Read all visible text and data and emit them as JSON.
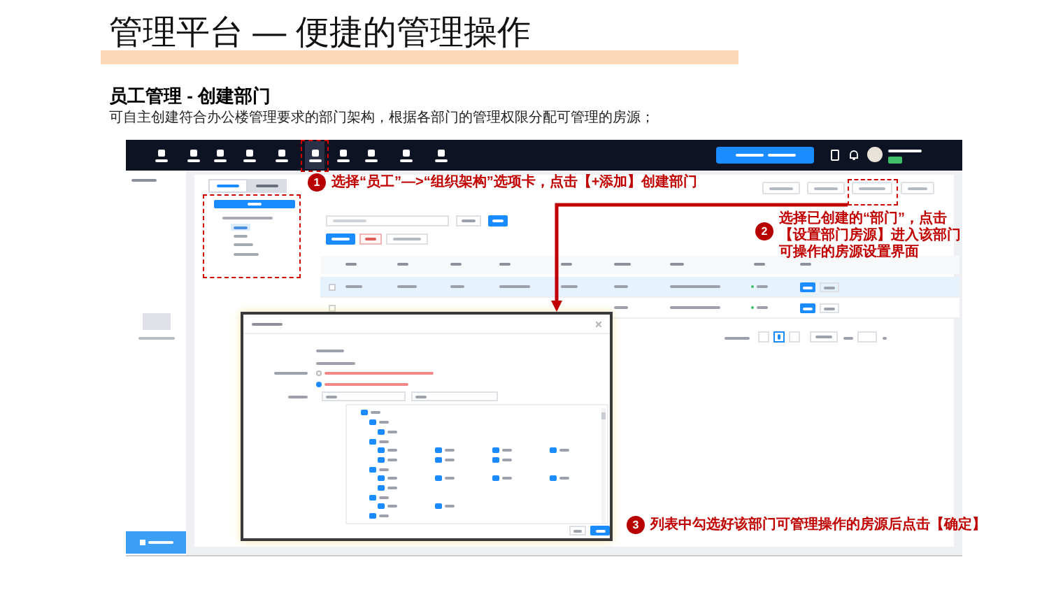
{
  "slide": {
    "title": "管理平台 — 便捷的管理操作",
    "heading": "员工管理 - 创建部门",
    "description": "可自主创建符合办公楼管理要求的部门架构，根据各部门的管理权限分配可管理的房源；"
  },
  "callouts": [
    {
      "number": "1",
      "text": "选择“员工”—>“组织架构”选项卡，点击【+添加】创建部门"
    },
    {
      "number": "2",
      "text": "选择已创建的“部门”，点击【设置部门房源】进入该部门可操作的房源设置界面"
    },
    {
      "number": "3",
      "text": "列表中勾选好该部门可管理操作的房源后点击【确定】"
    }
  ],
  "app_screenshot": {
    "nav_items": [
      {
        "selected": false
      },
      {
        "selected": false
      },
      {
        "selected": false
      },
      {
        "selected": false
      },
      {
        "selected": false
      },
      {
        "selected": true
      },
      {
        "selected": false
      },
      {
        "selected": false
      },
      {
        "selected": false
      },
      {
        "selected": false
      }
    ],
    "tabs": [
      {
        "selected": true
      },
      {
        "selected": false
      }
    ],
    "tree_items": [
      {
        "selected": false
      },
      {
        "selected": true
      },
      {
        "selected": false
      },
      {
        "selected": false
      },
      {
        "selected": false
      }
    ],
    "table_rows": [
      {
        "checked": false,
        "selected": true
      },
      {
        "checked": false,
        "selected": false
      }
    ],
    "radio_options": [
      {
        "selected": false
      },
      {
        "selected": true
      }
    ],
    "room_tree": [
      {
        "checked": true,
        "children": [
          {
            "checked": true,
            "children": [
              {
                "checked": true
              }
            ]
          },
          {
            "checked": true,
            "children": [
              {
                "checked": true
              },
              {
                "checked": true
              },
              {
                "checked": true
              },
              {
                "checked": true
              },
              {
                "checked": true
              },
              {
                "checked": true
              },
              {
                "checked": true
              }
            ]
          },
          {
            "checked": true,
            "children": [
              {
                "checked": true
              },
              {
                "checked": true
              },
              {
                "checked": true
              },
              {
                "checked": true
              },
              {
                "checked": true
              }
            ]
          },
          {
            "checked": true,
            "children": [
              {
                "checked": true
              },
              {
                "checked": true
              }
            ]
          },
          {
            "checked": true
          }
        ]
      }
    ]
  }
}
